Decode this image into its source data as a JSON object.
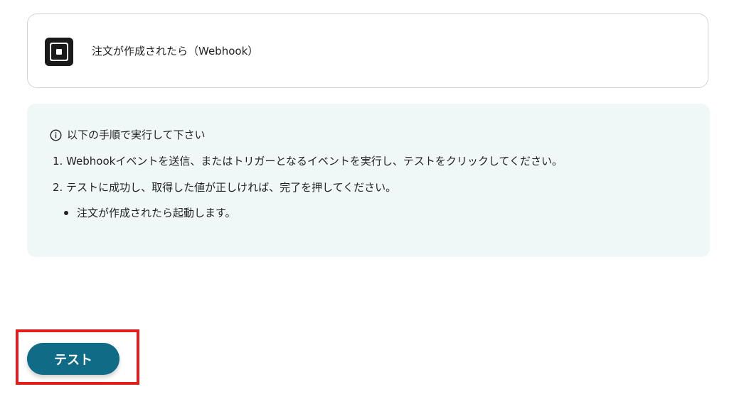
{
  "trigger": {
    "app_icon": "square-logo-icon",
    "title": "注文が作成されたら（Webhook）"
  },
  "instructions": {
    "heading": "以下の手順で実行して下さい",
    "heading_icon": "info-circle-icon",
    "steps": [
      "1. Webhookイベントを送信、またはトリガーとなるイベントを実行し、テストをクリックしてください。",
      "2. テストに成功し、取得した値が正しければ、完了を押してください。"
    ],
    "notes": [
      "注文が作成されたら起動します。"
    ],
    "background_color": "#eff8f7"
  },
  "actions": {
    "test_label": "テスト",
    "test_color": "#0f6b86",
    "highlight_color": "#e01e1e"
  }
}
